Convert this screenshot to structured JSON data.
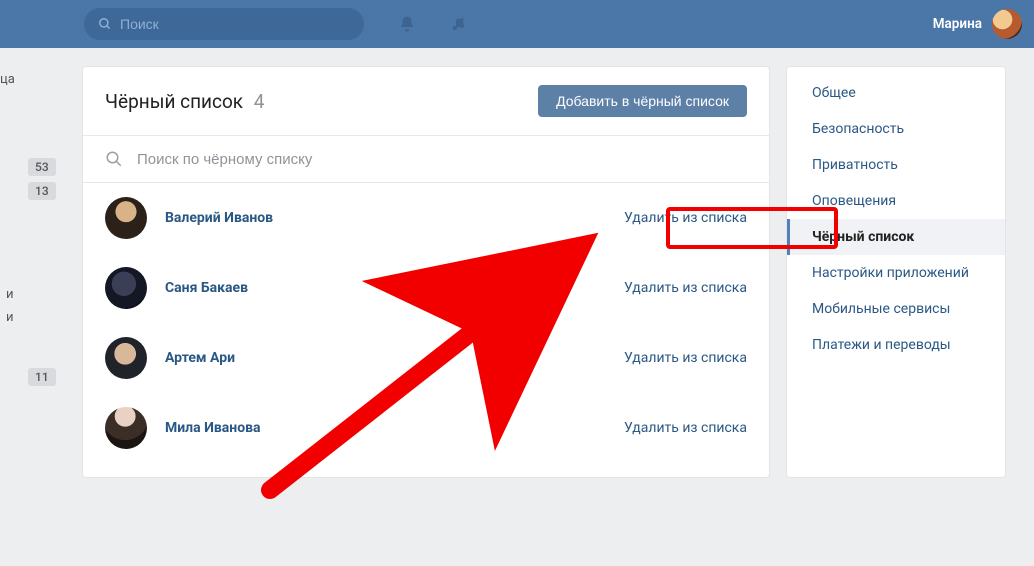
{
  "topbar": {
    "search_placeholder": "Поиск",
    "username": "Марина"
  },
  "left_fragment": {
    "cut_label": "ца",
    "badges": [
      "53",
      "13"
    ],
    "text_stub1": "и",
    "text_stub2": "и",
    "badge_low": "11"
  },
  "main": {
    "title": "Чёрный список",
    "count": "4",
    "add_button": "Добавить в чёрный список",
    "search_placeholder": "Поиск по чёрному списку",
    "remove_label": "Удалить из списка",
    "items": [
      {
        "name": "Валерий Иванов"
      },
      {
        "name": "Саня Бакаев"
      },
      {
        "name": "Артем Ари"
      },
      {
        "name": "Мила Иванова"
      }
    ]
  },
  "sidebar": {
    "items": [
      {
        "label": "Общее",
        "active": false
      },
      {
        "label": "Безопасность",
        "active": false
      },
      {
        "label": "Приватность",
        "active": false
      },
      {
        "label": "Оповещения",
        "active": false
      },
      {
        "label": "Чёрный список",
        "active": true
      },
      {
        "label": "Настройки приложений",
        "active": false
      },
      {
        "label": "Мобильные сервисы",
        "active": false
      },
      {
        "label": "Платежи и переводы",
        "active": false
      }
    ]
  }
}
